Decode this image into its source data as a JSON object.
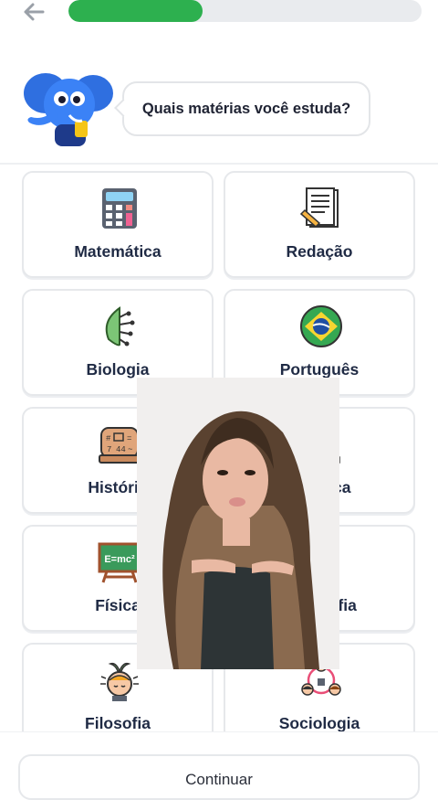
{
  "progress": {
    "value": 0.38,
    "color": "#2db04f"
  },
  "question": "Quais matérias você estuda?",
  "subjects": [
    {
      "label": "Matemática",
      "icon": "calculator-icon"
    },
    {
      "label": "Redação",
      "icon": "document-pen-icon"
    },
    {
      "label": "Biologia",
      "icon": "leaf-circuit-icon"
    },
    {
      "label": "Português",
      "icon": "brazil-flag-icon"
    },
    {
      "label": "História",
      "icon": "stone-tablet-icon"
    },
    {
      "label": "Química",
      "icon": "lab-flask-icon"
    },
    {
      "label": "Física",
      "icon": "chalkboard-emc2-icon"
    },
    {
      "label": "Geografia",
      "icon": "globe-icon"
    },
    {
      "label": "Filosofia",
      "icon": "thinking-head-icon"
    },
    {
      "label": "Sociologia",
      "icon": "people-network-icon"
    }
  ],
  "chalkboard_text": "E=mc²",
  "continue_label": "Continuar"
}
